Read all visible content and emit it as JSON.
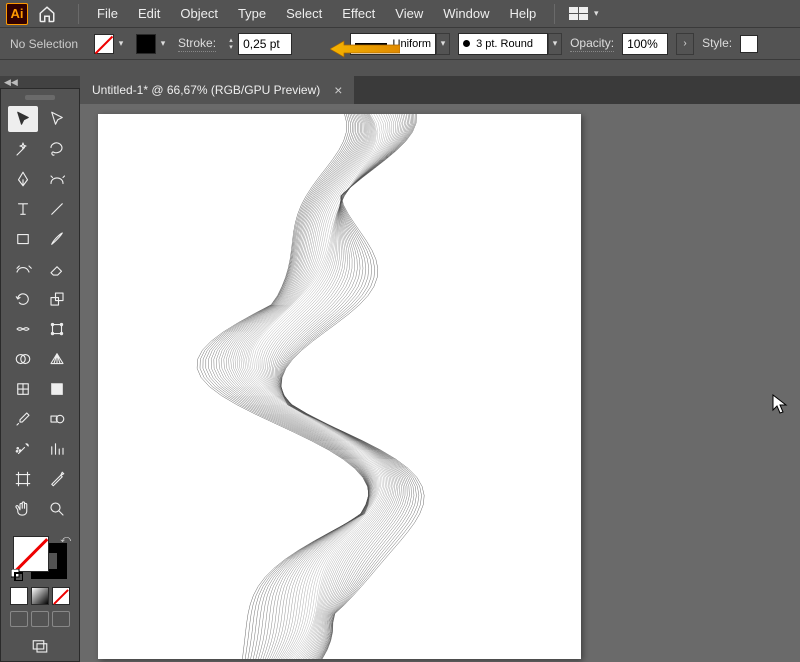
{
  "menubar": {
    "items": [
      "File",
      "Edit",
      "Object",
      "Type",
      "Select",
      "Effect",
      "View",
      "Window",
      "Help"
    ]
  },
  "controlbar": {
    "no_selection": "No Selection",
    "stroke_label": "Stroke:",
    "stroke_value": "0,25 pt",
    "profile_label": "Uniform",
    "brush_label": "3 pt. Round",
    "opacity_label": "Opacity:",
    "opacity_value": "100%",
    "style_label": "Style:"
  },
  "document": {
    "tab_title": "Untitled-1* @ 66,67% (RGB/GPU Preview)"
  },
  "tools": {
    "rows": [
      [
        "selection",
        "direct-selection"
      ],
      [
        "magic-wand",
        "lasso"
      ],
      [
        "pen",
        "curvature"
      ],
      [
        "type",
        "line"
      ],
      [
        "rectangle",
        "paintbrush"
      ],
      [
        "shaper",
        "eraser"
      ],
      [
        "rotate",
        "scale"
      ],
      [
        "width",
        "free-transform"
      ],
      [
        "shape-builder",
        "perspective"
      ],
      [
        "mesh",
        "gradient"
      ],
      [
        "eyedropper",
        "blend"
      ],
      [
        "symbol-sprayer",
        "column-graph"
      ],
      [
        "artboard",
        "slice"
      ],
      [
        "hand",
        "zoom"
      ]
    ]
  },
  "colors": {
    "fill": "none",
    "stroke": "#000000"
  }
}
